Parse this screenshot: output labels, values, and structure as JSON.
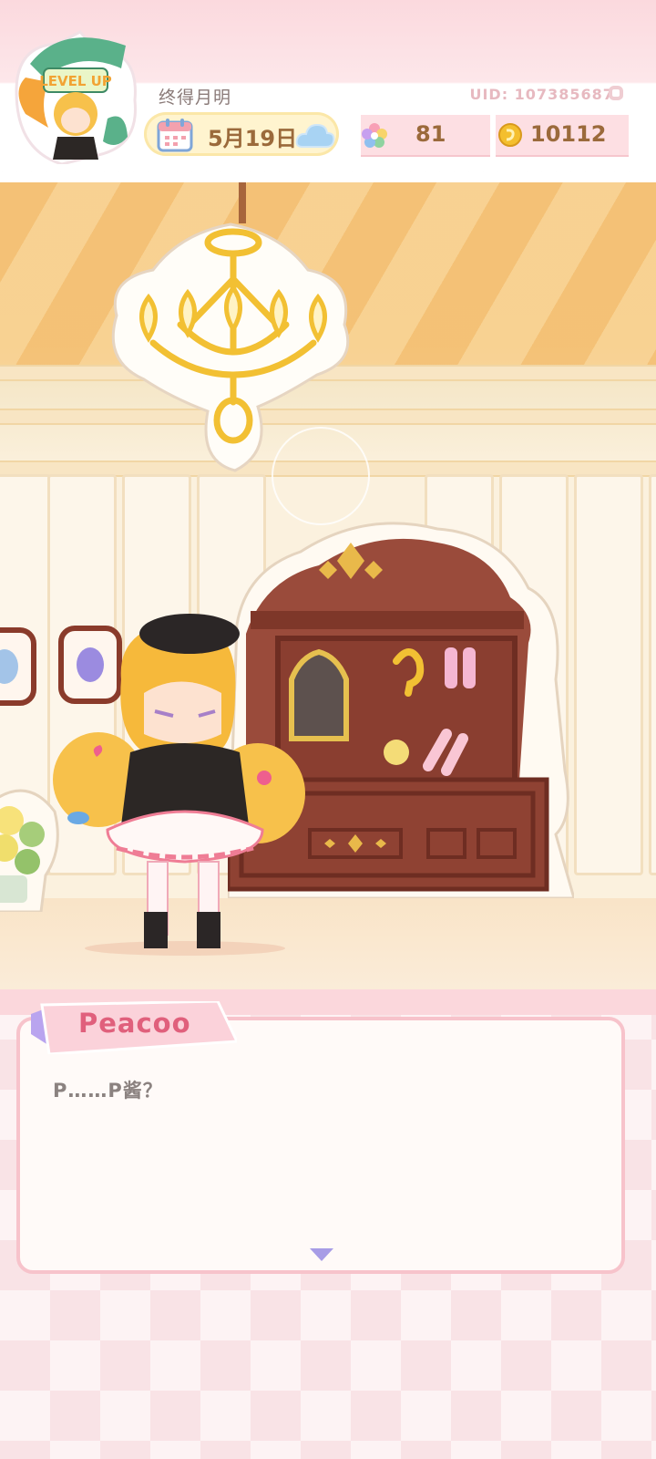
{
  "player": {
    "name": "终得月明",
    "uid": "UID: 1073856873",
    "avatar_badge_text": "LEVEL UP"
  },
  "date": {
    "label": "5月19日",
    "calendar_icon": "calendar-icon",
    "weather_icon": "cloud-icon"
  },
  "currency": {
    "gems": "81",
    "gem_icon": "rainbow-flower-icon",
    "coins": "10112",
    "coin_icon": "gold-coin-icon"
  },
  "dialog": {
    "speaker": "Peacoo",
    "text": "P……P酱？",
    "next_icon": "triangle-down-icon"
  },
  "colors": {
    "accent_pink": "#f7c3cb",
    "speaker_pink": "#e0607c",
    "gold_text": "#9b6a3b"
  }
}
